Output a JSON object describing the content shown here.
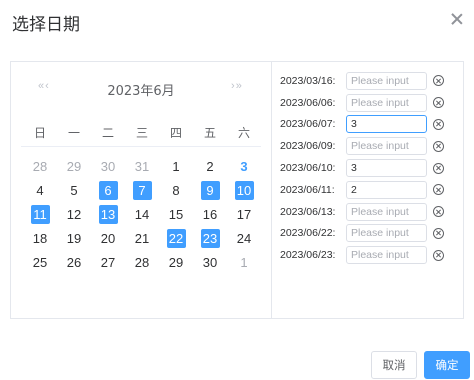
{
  "dialog": {
    "title": "选择日期"
  },
  "calendar": {
    "prev_label": "« ‹",
    "next_label": "› »",
    "header": "2023年6月",
    "weekdays": [
      "日",
      "一",
      "二",
      "三",
      "四",
      "五",
      "六"
    ],
    "days": [
      {
        "n": "28",
        "t": "other"
      },
      {
        "n": "29",
        "t": "other"
      },
      {
        "n": "30",
        "t": "other"
      },
      {
        "n": "31",
        "t": "other"
      },
      {
        "n": "1",
        "t": ""
      },
      {
        "n": "2",
        "t": ""
      },
      {
        "n": "3",
        "t": "today"
      },
      {
        "n": "4",
        "t": ""
      },
      {
        "n": "5",
        "t": ""
      },
      {
        "n": "6",
        "t": "selected"
      },
      {
        "n": "7",
        "t": "selected"
      },
      {
        "n": "8",
        "t": ""
      },
      {
        "n": "9",
        "t": "selected"
      },
      {
        "n": "10",
        "t": "selected"
      },
      {
        "n": "11",
        "t": "selected"
      },
      {
        "n": "12",
        "t": ""
      },
      {
        "n": "13",
        "t": "selected"
      },
      {
        "n": "14",
        "t": ""
      },
      {
        "n": "15",
        "t": ""
      },
      {
        "n": "16",
        "t": ""
      },
      {
        "n": "17",
        "t": ""
      },
      {
        "n": "18",
        "t": ""
      },
      {
        "n": "19",
        "t": ""
      },
      {
        "n": "20",
        "t": ""
      },
      {
        "n": "21",
        "t": ""
      },
      {
        "n": "22",
        "t": "selected"
      },
      {
        "n": "23",
        "t": "selected"
      },
      {
        "n": "24",
        "t": ""
      },
      {
        "n": "25",
        "t": ""
      },
      {
        "n": "26",
        "t": ""
      },
      {
        "n": "27",
        "t": ""
      },
      {
        "n": "28",
        "t": ""
      },
      {
        "n": "29",
        "t": ""
      },
      {
        "n": "30",
        "t": ""
      },
      {
        "n": "1",
        "t": "other"
      }
    ]
  },
  "entries": [
    {
      "date": "2023/03/16:",
      "value": "",
      "placeholder": "Please input",
      "focused": false
    },
    {
      "date": "2023/06/06:",
      "value": "",
      "placeholder": "Please input",
      "focused": false
    },
    {
      "date": "2023/06/07:",
      "value": "3",
      "placeholder": "Please input",
      "focused": true
    },
    {
      "date": "2023/06/09:",
      "value": "",
      "placeholder": "Please input",
      "focused": false
    },
    {
      "date": "2023/06/10:",
      "value": "3",
      "placeholder": "Please input",
      "focused": false
    },
    {
      "date": "2023/06/11:",
      "value": "2",
      "placeholder": "Please input",
      "focused": false
    },
    {
      "date": "2023/06/13:",
      "value": "",
      "placeholder": "Please input",
      "focused": false
    },
    {
      "date": "2023/06/22:",
      "value": "",
      "placeholder": "Please input",
      "focused": false
    },
    {
      "date": "2023/06/23:",
      "value": "",
      "placeholder": "Please input",
      "focused": false
    }
  ],
  "footer": {
    "cancel_label": "取消",
    "confirm_label": "确定"
  },
  "colors": {
    "accent": "#409eff",
    "border": "#dcdfe6"
  }
}
